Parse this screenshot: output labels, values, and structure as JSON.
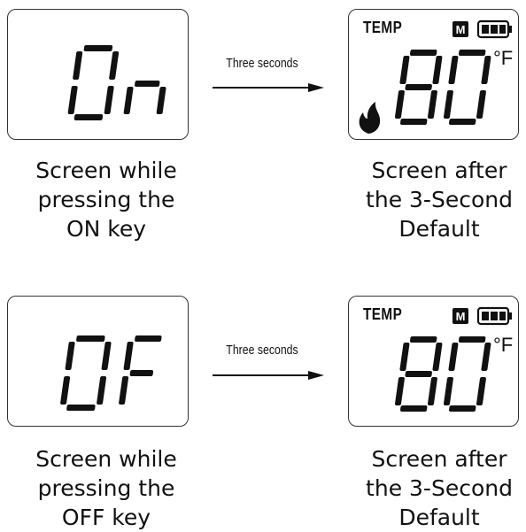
{
  "rows": [
    {
      "before_display": "On",
      "arrow_label": "Three seconds",
      "after": {
        "temp_label": "TEMP",
        "mode_icon": "M",
        "battery": "battery-full-icon",
        "value": "80",
        "unit": "°F",
        "flame_icon": true
      },
      "caption_left": [
        "Screen while",
        "pressing the",
        "ON key"
      ],
      "caption_right": [
        "Screen after",
        "the 3-Second",
        "Default"
      ]
    },
    {
      "before_display": "OF",
      "arrow_label": "Three seconds",
      "after": {
        "temp_label": "TEMP",
        "mode_icon": "M",
        "battery": "battery-full-icon",
        "value": "80",
        "unit": "°F",
        "flame_icon": false
      },
      "caption_left": [
        "Screen while",
        "pressing the",
        "OFF key"
      ],
      "caption_right": [
        "Screen after",
        "the 3-Second",
        "Default"
      ]
    }
  ]
}
